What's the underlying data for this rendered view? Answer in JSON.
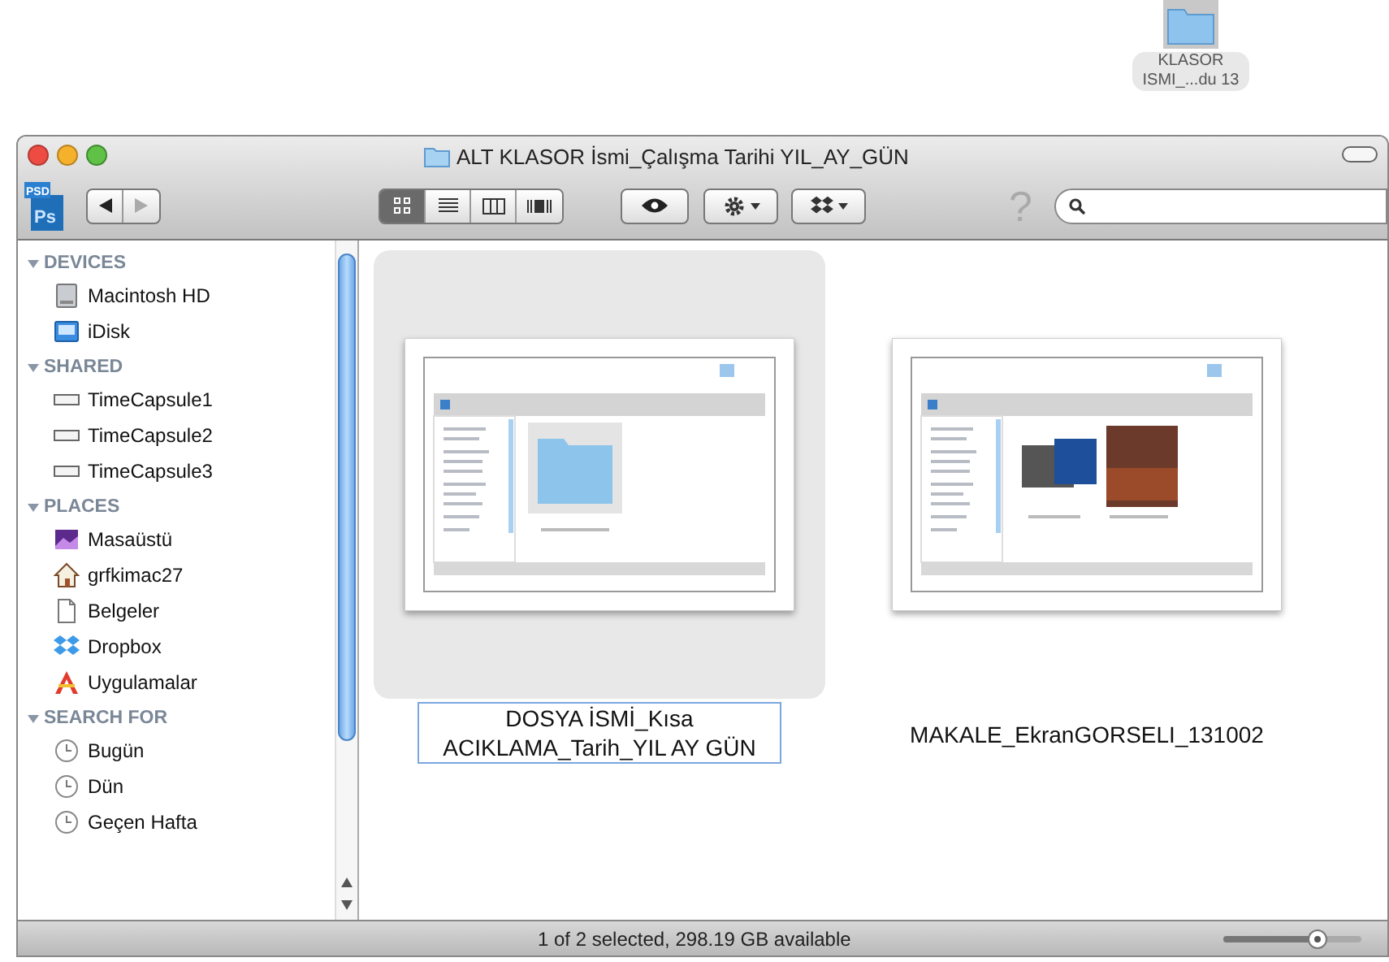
{
  "desktop_icon": {
    "label_lines": [
      "KLASOR",
      "ISMI_...du 13"
    ]
  },
  "window": {
    "title": "ALT KLASOR İsmi_Çalışma Tarihi YIL_AY_GÜN"
  },
  "toolbar": {
    "file_badge": {
      "top": "PSD",
      "main": "Ps"
    },
    "view_modes": [
      {
        "kind": "icons",
        "selected": true
      },
      {
        "kind": "list",
        "selected": false
      },
      {
        "kind": "columns",
        "selected": false
      },
      {
        "kind": "coverflow",
        "selected": false
      }
    ],
    "help": "?"
  },
  "sidebar": {
    "sections": [
      {
        "title": "DEVICES",
        "expanded": true,
        "items": [
          {
            "label": "Macintosh HD",
            "kind": "disk"
          },
          {
            "label": "iDisk",
            "kind": "idisk"
          }
        ]
      },
      {
        "title": "SHARED",
        "expanded": true,
        "items": [
          {
            "label": "TimeCapsule1",
            "kind": "server"
          },
          {
            "label": "TimeCapsule2",
            "kind": "server"
          },
          {
            "label": "TimeCapsule3",
            "kind": "server"
          }
        ]
      },
      {
        "title": "PLACES",
        "expanded": true,
        "items": [
          {
            "label": "Masaüstü",
            "kind": "desktop"
          },
          {
            "label": "grfkimac27",
            "kind": "home"
          },
          {
            "label": "Belgeler",
            "kind": "document"
          },
          {
            "label": "Dropbox",
            "kind": "dropbox"
          },
          {
            "label": "Uygulamalar",
            "kind": "apps"
          }
        ]
      },
      {
        "title": "SEARCH FOR",
        "expanded": true,
        "items": [
          {
            "label": "Bugün",
            "kind": "clock"
          },
          {
            "label": "Dün",
            "kind": "clock"
          },
          {
            "label": "Geçen Hafta",
            "kind": "clock"
          }
        ]
      }
    ]
  },
  "files": [
    {
      "name": "DOSYA İSMİ_Kısa ACIKLAMA_Tarih_YIL AY GÜN",
      "selected": true,
      "kind": "folder-shot"
    },
    {
      "name": "MAKALE_EkranGORSELI_131002",
      "selected": false,
      "kind": "photo-shot"
    }
  ],
  "status_bar": {
    "text": "1 of 2 selected, 298.19 GB available",
    "zoom": {
      "level": 0.68
    }
  }
}
